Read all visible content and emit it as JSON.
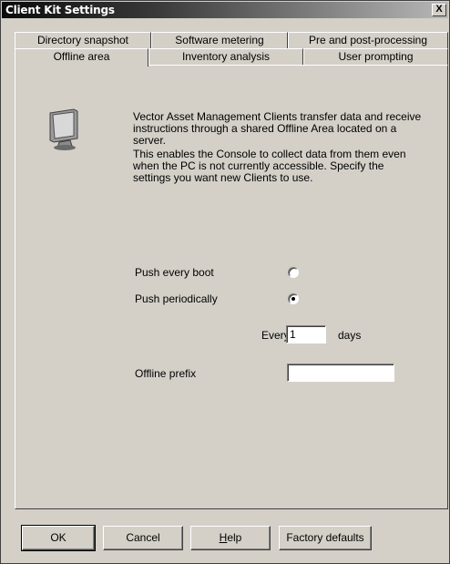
{
  "window": {
    "title": "Client Kit Settings",
    "close_label": "X"
  },
  "tabs": {
    "row1": [
      "Directory snapshot",
      "Software metering",
      "Pre and post-processing"
    ],
    "row2": [
      "Offline area",
      "Inventory analysis",
      "User prompting"
    ],
    "active": "Offline area"
  },
  "description": {
    "para1": "Vector Asset Management Clients transfer data and receive instructions through a shared Offline Area located on a server.",
    "para2": "This enables the Console to collect data from them even when the PC is not currently accessible. Specify the settings you want new Clients to use."
  },
  "options": {
    "push_every_boot": {
      "label": "Push every boot",
      "selected": false
    },
    "push_periodically": {
      "label": "Push periodically",
      "selected": true
    },
    "every_label": "Every",
    "every_value": "1",
    "days_label": "days",
    "offline_prefix_label": "Offline prefix",
    "offline_prefix_value": ""
  },
  "buttons": {
    "ok": "OK",
    "cancel": "Cancel",
    "help_first": "H",
    "help_rest": "elp",
    "factory_defaults": "Factory defaults"
  },
  "icons": {
    "monitor": "monitor-icon",
    "close": "close-icon"
  }
}
